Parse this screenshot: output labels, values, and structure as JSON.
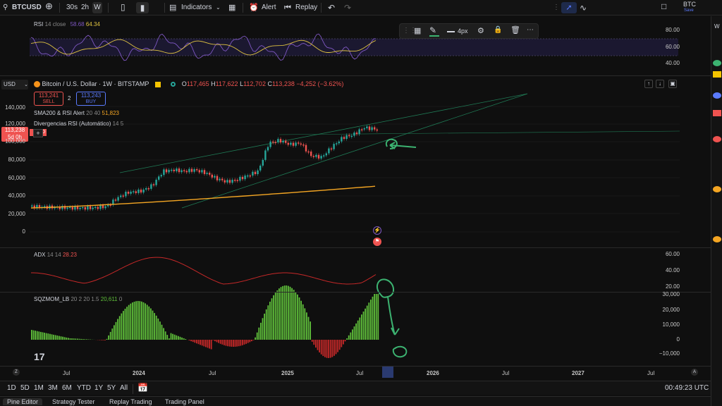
{
  "topbar": {
    "symbol": "BTCUSD",
    "intervals": [
      "30s",
      "2h",
      "W"
    ],
    "indicators_label": "Indicators",
    "alert_label": "Alert",
    "replay_label": "Replay",
    "account_label": "BTC",
    "save_label": "Save"
  },
  "drawing_toolbar": {
    "width_label": "4px"
  },
  "rsi": {
    "label": "RSI",
    "params": "14 close",
    "value1": "58.68",
    "value2": "64.34",
    "axis": [
      "80.00",
      "60.00",
      "40.00"
    ]
  },
  "main": {
    "title": "Bitcoin / U.S. Dollar · 1W · BITSTAMP",
    "ohlc": {
      "o_label": "O",
      "o": "117,465",
      "h_label": "H",
      "h": "117,622",
      "l_label": "L",
      "l": "112,702",
      "c_label": "C",
      "c": "113,238",
      "change": "−4,252 (−3.62%)"
    },
    "currency": "USD",
    "sell_price": "113,241",
    "sell_label": "SELL",
    "spread": "2",
    "buy_price": "113,243",
    "buy_label": "BUY",
    "indicator1_name": "SMA200 & RSI Alert",
    "indicator1_params": "20 40",
    "indicator1_value": "51,823",
    "indicator2_name": "Divergencias RSI (Automático)",
    "indicator2_params": "14 5",
    "price_tag": "113,238",
    "price_tag_time": "5d 0h",
    "price_tag_ccy": "USD",
    "axis": [
      "140,000",
      "120,000",
      "100,000",
      "80,000",
      "60,000",
      "40,000",
      "20,000",
      "0"
    ]
  },
  "adx": {
    "label": "ADX",
    "params": "14 14",
    "value": "28.23",
    "axis": [
      "60.00",
      "40.00",
      "20.00"
    ]
  },
  "sqz": {
    "label": "SQZMOM_LB",
    "params": "20 2 20 1.5",
    "value1": "20,611",
    "value2": "0",
    "axis": [
      "30,000",
      "20,000",
      "10,000",
      "0",
      "−10,000"
    ]
  },
  "time_axis": [
    "Jul",
    "2024",
    "Jul",
    "2025",
    "Jul",
    "2026",
    "Jul",
    "2027",
    "Jul"
  ],
  "bottombar": {
    "ranges": [
      "1D",
      "5D",
      "1M",
      "3M",
      "6M",
      "YTD",
      "1Y",
      "5Y",
      "All"
    ],
    "clock": "00:49:23 UTC"
  },
  "tabs": [
    "Pine Editor",
    "Strategy Tester",
    "Replay Trading",
    "Trading Panel"
  ],
  "colors": {
    "up": "#26a69a",
    "down": "#ef5350",
    "sma": "#f5a623",
    "rsi": "#7e57c2",
    "rsi_ma": "#e0c341",
    "adx": "#c62828",
    "sqz_up": "#5fbf3a",
    "sqz_down": "#c62828",
    "annotation": "#3cb371"
  }
}
